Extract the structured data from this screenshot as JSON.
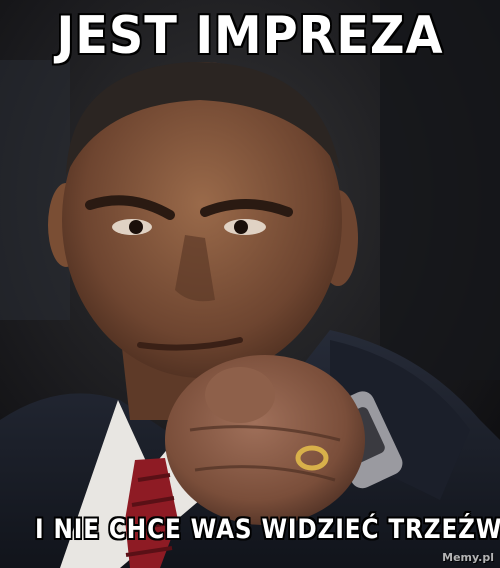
{
  "meme": {
    "top_text": "JEST IMPREZA",
    "bottom_text": "I NIE CHCE WAS WIDZIEĆ TRZEŹWYCH",
    "watermark": "Memy.pl"
  },
  "colors": {
    "caption_text": "#ffffff",
    "caption_outline": "#000000",
    "background": "#1d1d1f",
    "suit": "#1b1f2a",
    "shirt": "#e8e6e2",
    "tie": "#8e1b24",
    "skin": "#7a4e34"
  }
}
